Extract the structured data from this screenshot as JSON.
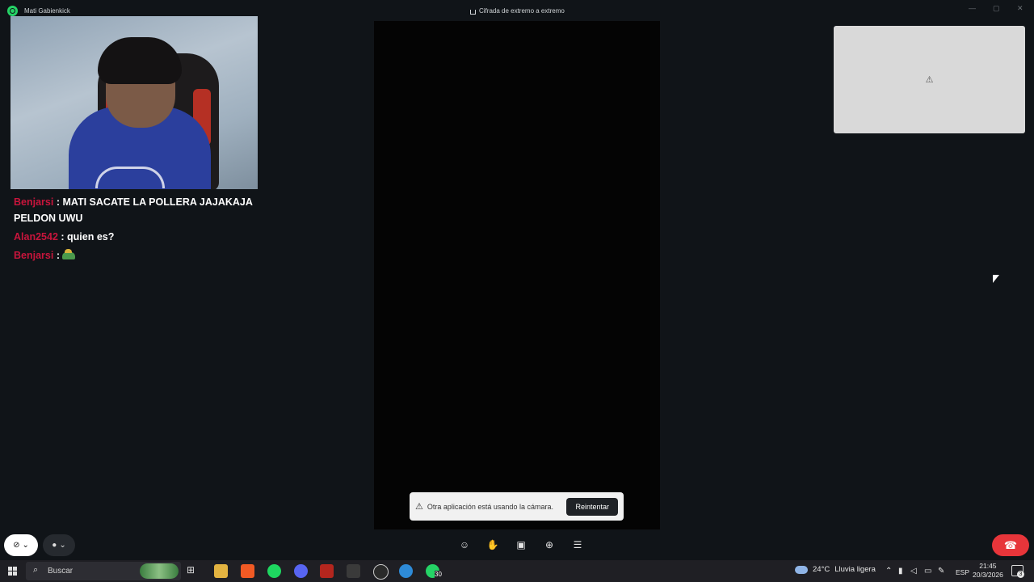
{
  "window": {
    "app_title": "Mati Gabienkick",
    "encryption_label": "Cifrada de extremo a extremo",
    "minimize": "—",
    "maximize": "▢",
    "close": "✕"
  },
  "chat": {
    "messages": [
      {
        "user": "Benjarsi",
        "separator": " : ",
        "text": "MATI SACATE LA POLLERA JAJAKAJA PELDON UWU"
      },
      {
        "user": "Alan2542",
        "separator": " : ",
        "text": "quien es?"
      },
      {
        "user": "Benjarsi",
        "separator": " : ",
        "text": ""
      }
    ]
  },
  "call": {
    "camera_toast": {
      "message": "Otra aplicación está usando la cámara.",
      "retry_label": "Reintentar",
      "icon": "warning-icon"
    },
    "pip_icon": "warning-icon",
    "controls": {
      "camera": "video-off-icon",
      "microphone": "mic-icon",
      "toolbar": [
        "emoji-icon",
        "raise-hand-icon",
        "screen-share-icon",
        "add-participant-icon",
        "more-options-icon"
      ],
      "end_call": "hang-up-icon"
    }
  },
  "taskbar": {
    "search_placeholder": "Buscar",
    "apps": [
      "task-view-icon",
      "file-explorer-icon",
      "brave-icon",
      "spotify-icon",
      "discord-icon",
      "voicemeeter-icon",
      "media-app-icon",
      "obs-icon",
      "browser-c-icon",
      "whatsapp-icon"
    ],
    "whatsapp_badge": "30",
    "weather": {
      "temp": "24°C",
      "condition": "Lluvia ligera"
    },
    "language": "ESP",
    "time": "21:45",
    "date": "20/3/2026",
    "notification_count": "3"
  },
  "colors": {
    "background": "#101418",
    "username": "#c8153c",
    "end_call": "#e7353a"
  }
}
